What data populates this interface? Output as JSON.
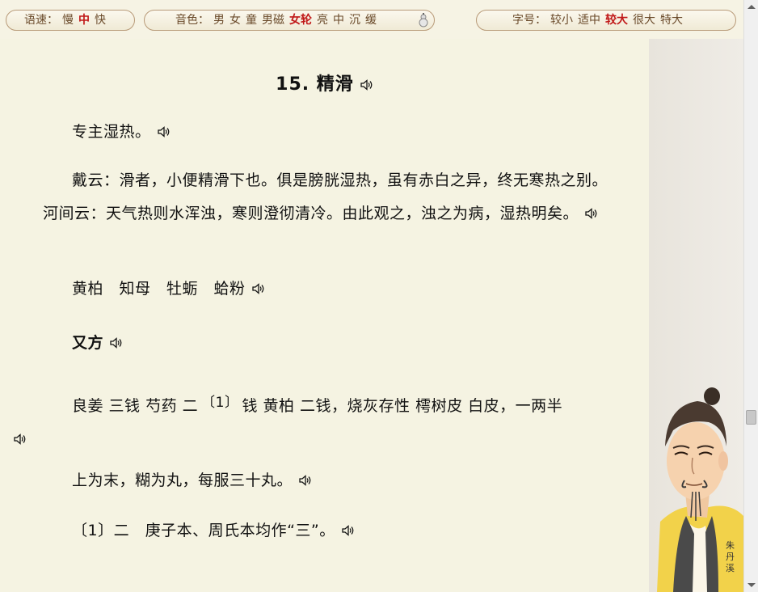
{
  "toolbar": {
    "speed": {
      "label": "语速：",
      "options": [
        "慢",
        "中",
        "快"
      ],
      "selected": "中"
    },
    "voice": {
      "label": "音色：",
      "options": [
        "男",
        "女",
        "童",
        "男磁",
        "女轮",
        "亮",
        "中",
        "沉",
        "缓"
      ],
      "selected": "女轮"
    },
    "size": {
      "label": "字号：",
      "options": [
        "较小",
        "适中",
        "较大",
        "很大",
        "特大"
      ],
      "selected": "较大"
    }
  },
  "article": {
    "title": "15. 精滑",
    "p1": "专主湿热。",
    "p2": "戴云：滑者，小便精滑下也。俱是膀胱湿热，虽有赤白之异，终无寒热之别。河间云：天气热则水浑浊，寒则澄彻清冷。由此观之，浊之为病，湿热明矣。",
    "p3": "黄柏　知母　牡蛎　蛤粉",
    "p4": "又方",
    "p5a": "良姜 三钱 芍药 二",
    "p5sup": "〔1〕",
    "p5b": "钱 黄柏 二钱，烧灰存性 樗树皮 白皮，一两半",
    "p6": "上为末，糊为丸，每服三十丸。",
    "p7": "〔1〕二　庚子本、周氏本均作“三”。"
  },
  "portrait": {
    "caption": "朱丹溪",
    "icon": "scholar-portrait"
  },
  "colors": {
    "selected": "#c01818",
    "pill_border": "#b89a78",
    "background": "#f4f1e1"
  }
}
